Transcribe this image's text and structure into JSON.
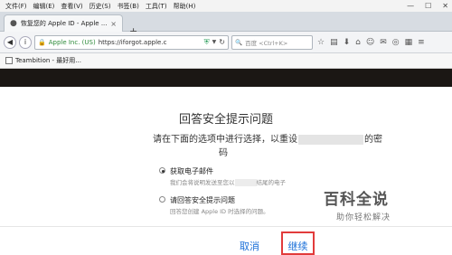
{
  "menu": [
    "文件(F)",
    "编辑(E)",
    "查看(V)",
    "历史(S)",
    "书签(B)",
    "工具(T)",
    "帮助(H)"
  ],
  "window": {
    "minimize": "—",
    "maximize": "☐",
    "close": "✕"
  },
  "tab": {
    "title": "恢复您的 Apple ID - Apple ...",
    "close": "×"
  },
  "newtab": "+",
  "nav": {
    "org": "Apple Inc. (US)",
    "url": "https://iforgot.apple.c",
    "search_placeholder": "百度 <Ctrl+K>"
  },
  "bookmarks": {
    "item": "Teambition - 最好用..."
  },
  "dialog": {
    "title": "回答安全提示问题",
    "subtitle_a": "请在下面的选项中进行选择，以重设",
    "subtitle_b": "的密",
    "subtitle_c": "码",
    "option1_label": "获取电子邮件",
    "option1_desc_a": "我们会将说明发送至您以",
    "option1_desc_b": "结尾的电子",
    "option2_label": "请回答安全提示问题",
    "option2_desc": "回答您创建 Apple ID 时选择的问题。",
    "cancel": "取消",
    "continue": "继续"
  },
  "watermark": {
    "main": "百科全说",
    "sub": "助你轻松解决"
  }
}
